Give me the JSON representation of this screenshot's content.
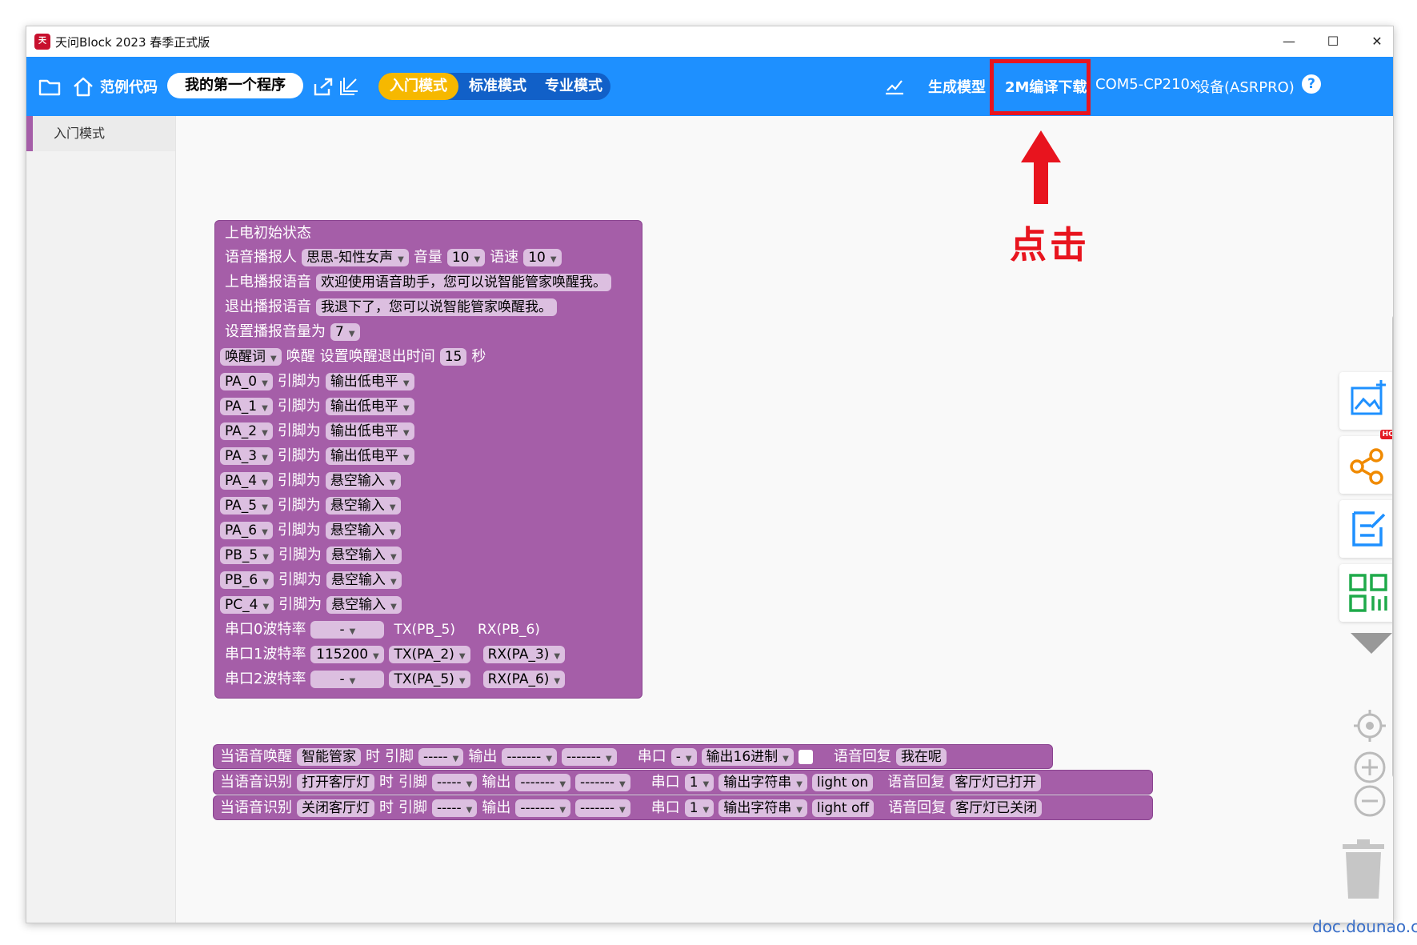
{
  "window": {
    "title": "天问Block 2023 春季正式版",
    "minimize": "—",
    "maximize": "☐",
    "close": "✕"
  },
  "toolbar": {
    "examples": "范例代码",
    "program_name": "我的第一个程序",
    "modes": [
      "入门模式",
      "标准模式",
      "专业模式"
    ],
    "generate_model": "生成模型",
    "compile_download": "2M编译下载",
    "port": "COM5-CP210x",
    "device": "设备(ASRPRO)",
    "help": "?"
  },
  "sidebar": {
    "items": [
      "入门模式"
    ]
  },
  "annotation": {
    "click": "点击"
  },
  "init_block": {
    "title": "上电初始状态",
    "speaker_label": "语音播报人",
    "speaker": "思思-知性女声",
    "volume_label": "音量",
    "volume": "10",
    "speed_label": "语速",
    "speed": "10",
    "startup_label": "上电播报语音",
    "startup_text": "欢迎使用语音助手，您可以说智能管家唤醒我。",
    "exit_label": "退出播报语音",
    "exit_text": "我退下了，您可以说智能管家唤醒我。",
    "set_volume_label": "设置播报音量为",
    "set_volume": "7",
    "wake_word": "唤醒词",
    "wake_label": "唤醒",
    "wake_timeout_label": "设置唤醒退出时间",
    "wake_timeout": "15",
    "seconds": "秒",
    "pin_label": "引脚为",
    "pins": [
      {
        "pin": "PA_0",
        "mode": "输出低电平"
      },
      {
        "pin": "PA_1",
        "mode": "输出低电平"
      },
      {
        "pin": "PA_2",
        "mode": "输出低电平"
      },
      {
        "pin": "PA_3",
        "mode": "输出低电平"
      },
      {
        "pin": "PA_4",
        "mode": "悬空输入"
      },
      {
        "pin": "PA_5",
        "mode": "悬空输入"
      },
      {
        "pin": "PA_6",
        "mode": "悬空输入"
      },
      {
        "pin": "PB_5",
        "mode": "悬空输入"
      },
      {
        "pin": "PB_6",
        "mode": "悬空输入"
      },
      {
        "pin": "PC_4",
        "mode": "悬空输入"
      }
    ],
    "uarts": [
      {
        "label": "串口0波特率",
        "baud": "-",
        "tx": "TX(PB_5)",
        "rx": "RX(PB_6)"
      },
      {
        "label": "串口1波特率",
        "baud": "115200",
        "tx": "TX(PA_2)",
        "rx": "RX(PA_3)"
      },
      {
        "label": "串口2波特率",
        "baud": "-",
        "tx": "TX(PA_5)",
        "rx": "RX(PA_6)"
      }
    ]
  },
  "event_blocks": [
    {
      "event": "当语音唤醒",
      "word": "智能管家",
      "when": "时",
      "pin_label": "引脚",
      "pin": "-----",
      "out_label": "输出",
      "out1": "-------",
      "out2": "-------",
      "uart_label": "串口",
      "uart": "-",
      "format": "输出16进制",
      "data": "",
      "reply_label": "语音回复",
      "reply": "我在呢"
    },
    {
      "event": "当语音识别",
      "word": "打开客厅灯",
      "when": "时",
      "pin_label": "引脚",
      "pin": "-----",
      "out_label": "输出",
      "out1": "-------",
      "out2": "-------",
      "uart_label": "串口",
      "uart": "1",
      "format": "输出字符串",
      "data": "light on",
      "reply_label": "语音回复",
      "reply": "客厅灯已打开"
    },
    {
      "event": "当语音识别",
      "word": "关闭客厅灯",
      "when": "时",
      "pin_label": "引脚",
      "pin": "-----",
      "out_label": "输出",
      "out1": "-------",
      "out2": "-------",
      "uart_label": "串口",
      "uart": "1",
      "format": "输出字符串",
      "data": "light off",
      "reply_label": "语音回复",
      "reply": "客厅灯已关闭"
    }
  ],
  "right_panel": {
    "hot_badge": "HOT"
  },
  "watermark": "doc.dounao.cn"
}
